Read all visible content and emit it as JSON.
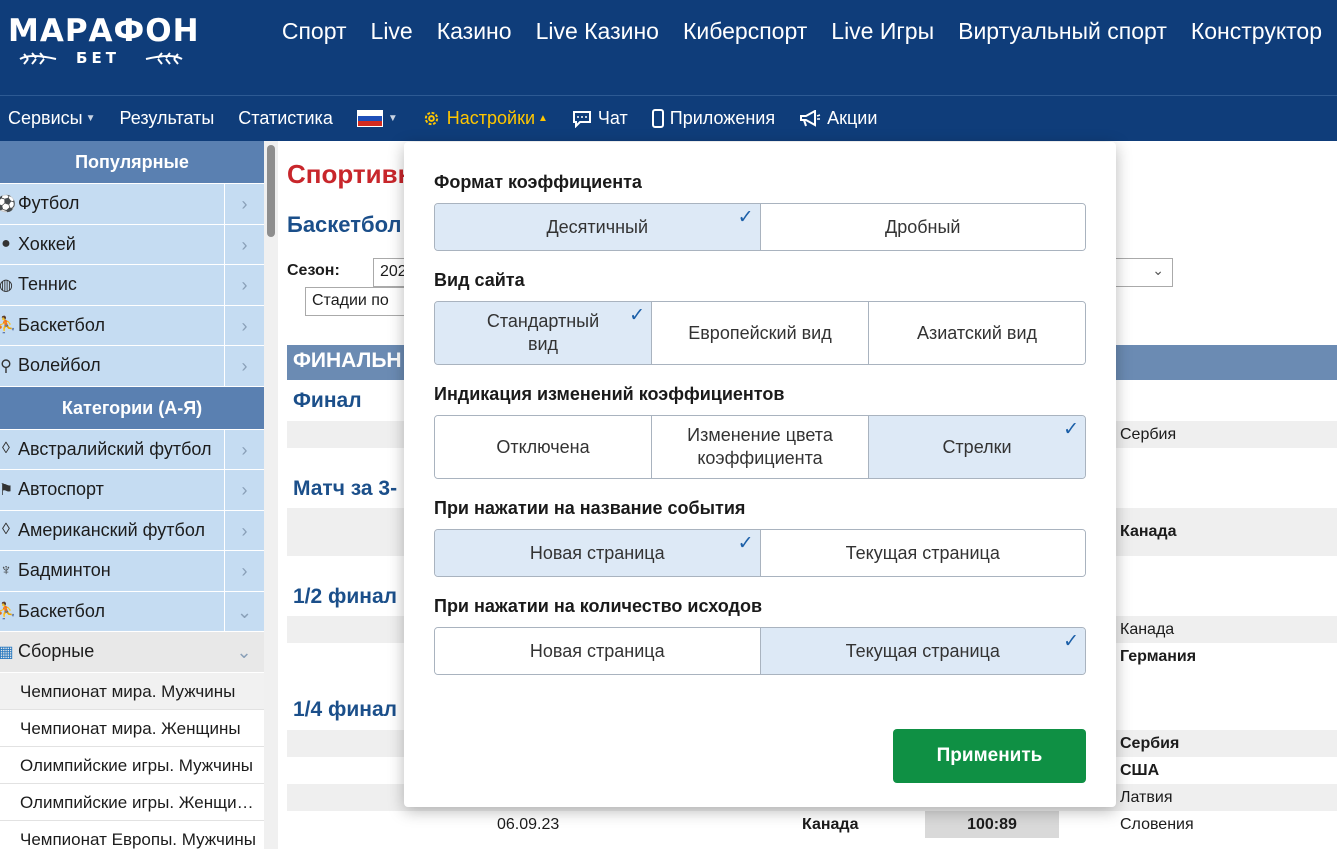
{
  "logo": {
    "main": "МАРАФОН",
    "sub": "БЕТ"
  },
  "top_nav": [
    "Спорт",
    "Live",
    "Казино",
    "Live Казино",
    "Киберспорт",
    "Live Игры",
    "Виртуальный спорт",
    "Конструктор"
  ],
  "sub_nav": {
    "services": "Сервисы",
    "results": "Результаты",
    "statistics": "Статистика",
    "settings": "Настройки",
    "chat": "Чат",
    "apps": "Приложения",
    "promos": "Акции"
  },
  "sidebar": {
    "popular_header": "Популярные",
    "popular": [
      {
        "label": "Футбол",
        "icon": "soccer-ball-icon"
      },
      {
        "label": "Хоккей",
        "icon": "hockey-puck-icon"
      },
      {
        "label": "Теннис",
        "icon": "tennis-ball-icon"
      },
      {
        "label": "Баскетбол",
        "icon": "basketball-icon"
      },
      {
        "label": "Волейбол",
        "icon": "volleyball-icon"
      }
    ],
    "categories_header": "Категории (А-Я)",
    "categories": [
      {
        "label": "Австралийский футбол",
        "icon": "aussie-football-icon"
      },
      {
        "label": "Автоспорт",
        "icon": "racing-flag-icon"
      },
      {
        "label": "Американский футбол",
        "icon": "american-football-icon"
      },
      {
        "label": "Бадминтон",
        "icon": "shuttlecock-icon"
      },
      {
        "label": "Баскетбол",
        "icon": "basketball-icon"
      },
      {
        "label": "Сборные",
        "icon": "world-map-icon"
      }
    ],
    "subitems": [
      "Чемпионат мира. Мужчины",
      "Чемпионат мира. Женщины",
      "Олимпийские игры. Мужчины",
      "Олимпийские игры. Женщины",
      "Чемпионат Европы. Мужчины"
    ]
  },
  "main": {
    "title": "Спортивн",
    "subtitle": "Баскетбол",
    "season_label": "Сезон:",
    "season_value": "202",
    "stage_value": "Стадии по",
    "band": "ФИНАЛЬН",
    "stages": [
      "Финал",
      "Матч за 3-",
      "1/2 финал",
      "1/4 финал"
    ],
    "rows": {
      "final_team": "Сербия",
      "third_team": "Канада",
      "semi_1": "Канада",
      "semi_2": "Германия",
      "qf_1": "Сербия",
      "qf_2": "США",
      "qf_3": "Латвия",
      "qf_4_date": "06.09.23",
      "qf_4_team": "Канада",
      "qf_4_score": "100:89",
      "qf_4_opp": "Словения"
    }
  },
  "settings_modal": {
    "odds_format": {
      "label": "Формат коэффициента",
      "options": [
        "Десятичный",
        "Дробный"
      ],
      "selected": 0
    },
    "site_view": {
      "label": "Вид сайта",
      "options": [
        "Стандартный вид",
        "Европейский вид",
        "Азиатский вид"
      ],
      "selected": 0
    },
    "odds_change": {
      "label": "Индикация изменений коэффициентов",
      "options": [
        "Отключена",
        "Изменение цвета коэффициента",
        "Стрелки"
      ],
      "selected": 2
    },
    "event_click": {
      "label": "При нажатии на название события",
      "options": [
        "Новая страница",
        "Текущая страница"
      ],
      "selected": 0
    },
    "outcomes_click": {
      "label": "При нажатии на количество исходов",
      "options": [
        "Новая страница",
        "Текущая страница"
      ],
      "selected": 1
    },
    "apply": "Применить"
  },
  "colors": {
    "brand": "#0f3d7a",
    "active_nav": "#ffc600",
    "apply": "#0f9044",
    "title": "#c8262b"
  }
}
